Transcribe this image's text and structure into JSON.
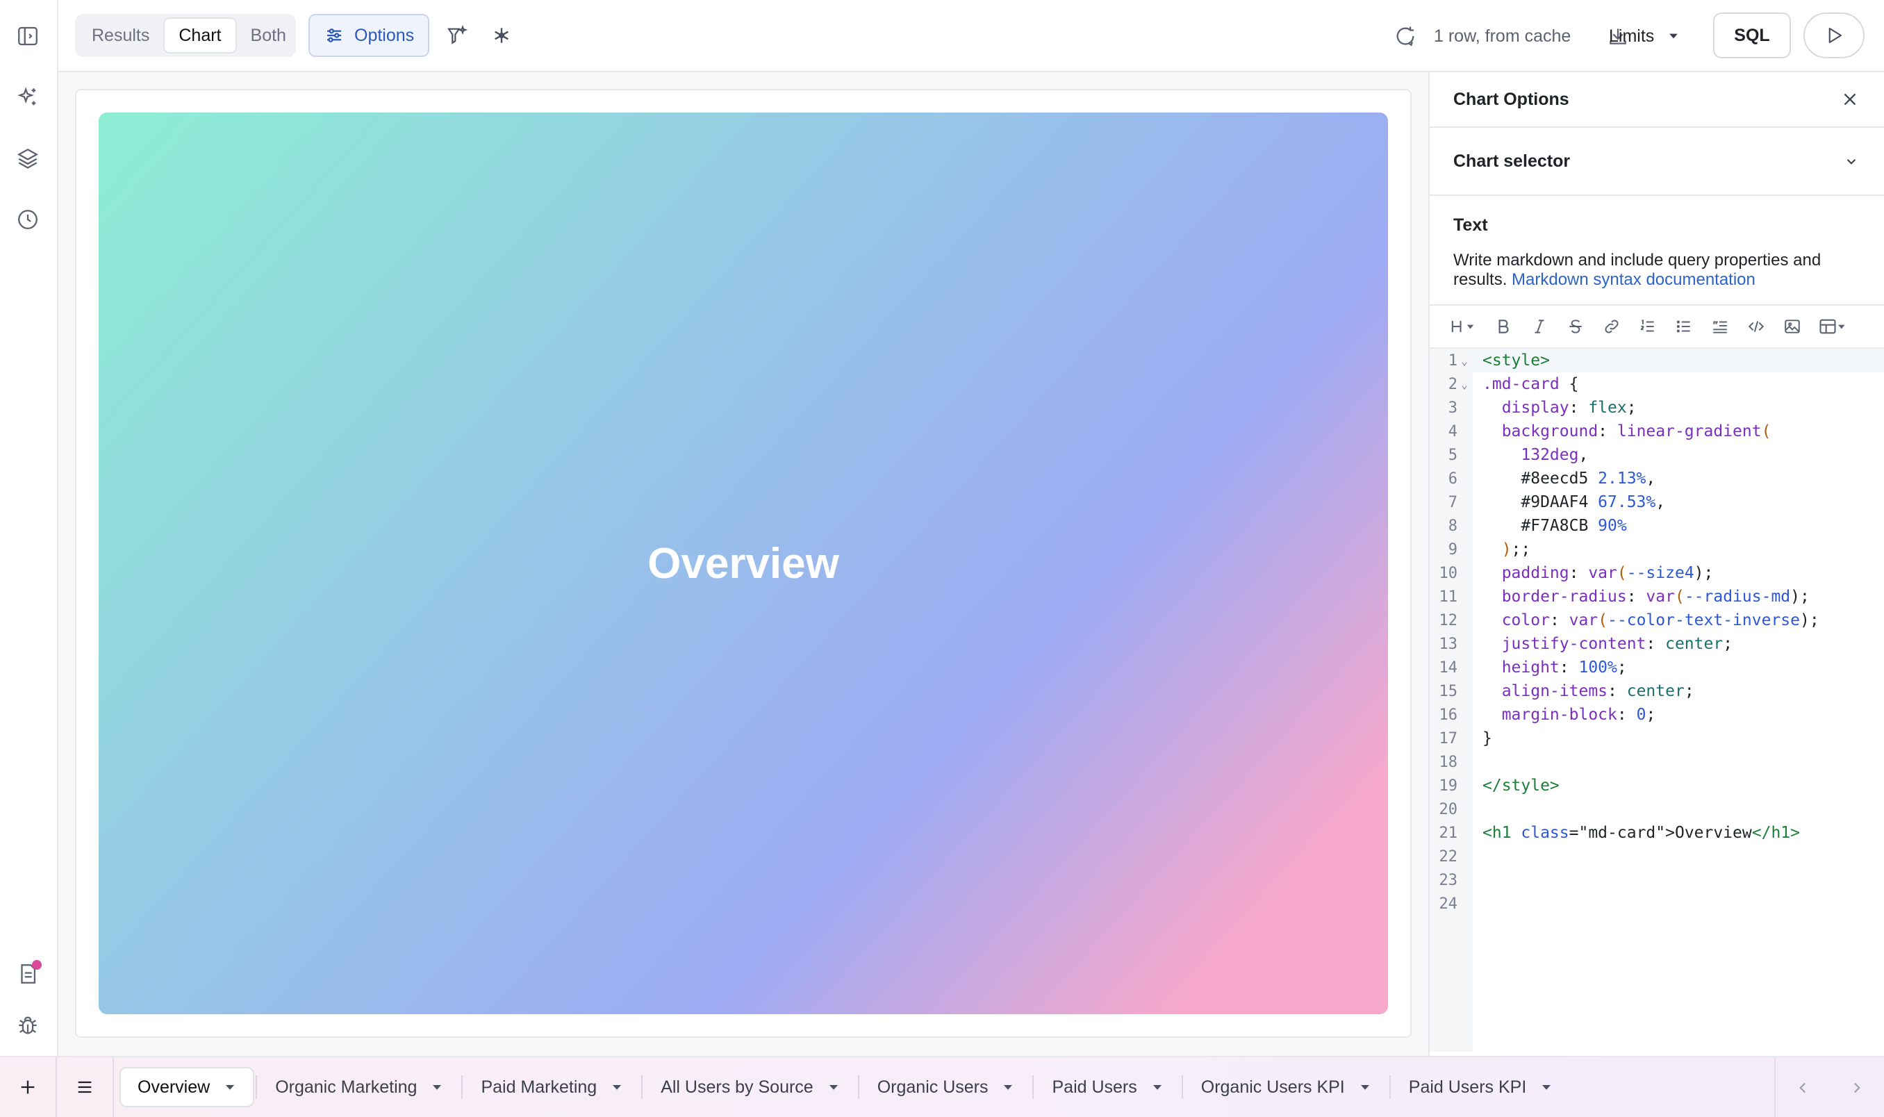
{
  "toolbar": {
    "view_tabs": [
      "Results",
      "Chart",
      "Both"
    ],
    "active_view": "Chart",
    "options_label": "Options",
    "status_text": "1 row, from cache",
    "limits_label": "Limits",
    "sql_label": "SQL"
  },
  "chart": {
    "heading": "Overview",
    "gradient": [
      "#8eecd5",
      "#9DAAF4",
      "#F7A8CB"
    ]
  },
  "panel": {
    "title": "Chart Options",
    "selector_label": "Chart selector",
    "text_heading": "Text",
    "text_desc": "Write markdown and include query properties and results.",
    "doc_link": "Markdown syntax documentation"
  },
  "editor": {
    "lines": [
      "1",
      "2",
      "3",
      "4",
      "5",
      "6",
      "7",
      "8",
      "9",
      "10",
      "11",
      "12",
      "13",
      "14",
      "15",
      "16",
      "17",
      "18",
      "19",
      "20",
      "21",
      "22",
      "23",
      "24"
    ],
    "code": {
      "l1": "<style>",
      "l2a": ".md-card",
      "l2b": " {",
      "l3a": "  display",
      "l3b": ": ",
      "l3c": "flex",
      "l3d": ";",
      "l4a": "  background",
      "l4b": ": ",
      "l4c": "linear-gradient",
      "l4d": "(",
      "l5a": "    132deg",
      "l5b": ",",
      "l6a": "    #8eecd5 ",
      "l6b": "2.13%",
      "l6c": ",",
      "l7a": "    #9DAAF4 ",
      "l7b": "67.53%",
      "l7c": ",",
      "l8a": "    #F7A8CB ",
      "l8b": "90%",
      "l9a": "  )",
      "l9b": ";;",
      "l10a": "  padding",
      "l10b": ": ",
      "l10c": "var",
      "l10d": "(",
      "l10e": "--size4",
      "l10f": ");",
      "l11a": "  border-radius",
      "l11b": ": ",
      "l11c": "var",
      "l11d": "(",
      "l11e": "--radius-md",
      "l11f": ");",
      "l12a": "  color",
      "l12b": ": ",
      "l12c": "var",
      "l12d": "(",
      "l12e": "--color-text-inverse",
      "l12f": ");",
      "l13a": "  justify-content",
      "l13b": ": ",
      "l13c": "center",
      "l13d": ";",
      "l14a": "  height",
      "l14b": ": ",
      "l14c": "100%",
      "l14d": ";",
      "l15a": "  align-items",
      "l15b": ": ",
      "l15c": "center",
      "l15d": ";",
      "l16a": "  margin-block",
      "l16b": ": ",
      "l16c": "0",
      "l16d": ";",
      "l17": "}",
      "l19": "</style>",
      "l21a": "<h1 ",
      "l21b": "class",
      "l21c": "=\"md-card\">",
      "l21d": "Overview",
      "l21e": "</h1>"
    }
  },
  "bottom_tabs": [
    "Overview",
    "Organic Marketing",
    "Paid Marketing",
    "All Users by Source",
    "Organic Users",
    "Paid Users",
    "Organic Users KPI",
    "Paid Users KPI"
  ],
  "active_tab": "Overview"
}
